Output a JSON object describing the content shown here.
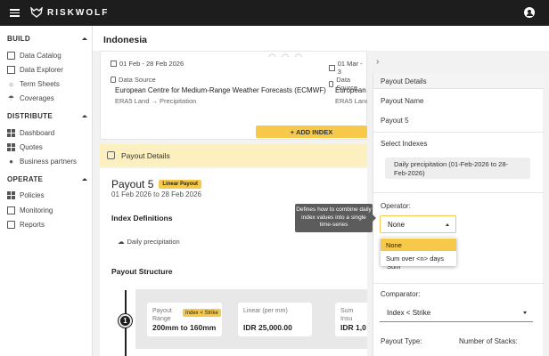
{
  "app": {
    "brand": "RISKWOLF"
  },
  "sidebar": {
    "sections": [
      {
        "title": "BUILD",
        "items": [
          "Data Catalog",
          "Data Explorer",
          "Term Sheets",
          "Coverages"
        ]
      },
      {
        "title": "DISTRIBUTE",
        "items": [
          "Dashboard",
          "Quotes",
          "Business partners"
        ]
      },
      {
        "title": "OPERATE",
        "items": [
          "Policies",
          "Monitoring",
          "Reports"
        ]
      }
    ]
  },
  "main": {
    "title": "Indonesia",
    "data_sources": [
      {
        "date": "01 Feb - 28 Feb 2026",
        "label": "Data Source",
        "name": "European Centre for Medium-Range Weather Forecasts (ECMWF)",
        "sub": "ERA5 Land → Precipitation"
      },
      {
        "date": "01 Mar - 3",
        "label": "Data Source",
        "name": "European C",
        "sub": "ERA5 Land"
      }
    ],
    "add_index_label": "+ ADD INDEX",
    "payout_banner": "Payout Details",
    "payout": {
      "title": "Payout 5",
      "badge": "Linear Payout",
      "dates": "01 Feb 2026 to 28 Feb 2026",
      "index_definitions": "Index Definitions",
      "daily_index": "Daily precipitation",
      "payout_structure": "Payout Structure",
      "step": "1",
      "cells": [
        {
          "label": "Payout Range",
          "badge": "Index < Strike",
          "value": "200mm to 160mm"
        },
        {
          "label": "Linear (per mm)",
          "value": "IDR 25,000.00"
        },
        {
          "label": "Sum Insu",
          "value": "IDR 1,0"
        }
      ]
    }
  },
  "tooltip": "Defines how to combine daily index values into a single time-series",
  "panel": {
    "header": "Payout Details",
    "payout_name_label": "Payout Name",
    "payout_name": "Payout 5",
    "select_indexes_label": "Select Indexes",
    "selected_index": "Daily precipitation (01-Feb-2026 to 28-Feb-2026)",
    "operator_label": "Operator:",
    "operator_value": "None",
    "operator_options": [
      "None",
      "Sum over <n> days"
    ],
    "hidden_select_value": "Sum",
    "comparator_label": "Comparator:",
    "comparator_value": "Index < Strike",
    "payout_type_label": "Payout Type:",
    "stacks_label": "Number of Stacks:"
  },
  "colors": {
    "accent": "#f6c94a",
    "topbar": "#1d1d1d",
    "banner": "#fcefc0"
  }
}
